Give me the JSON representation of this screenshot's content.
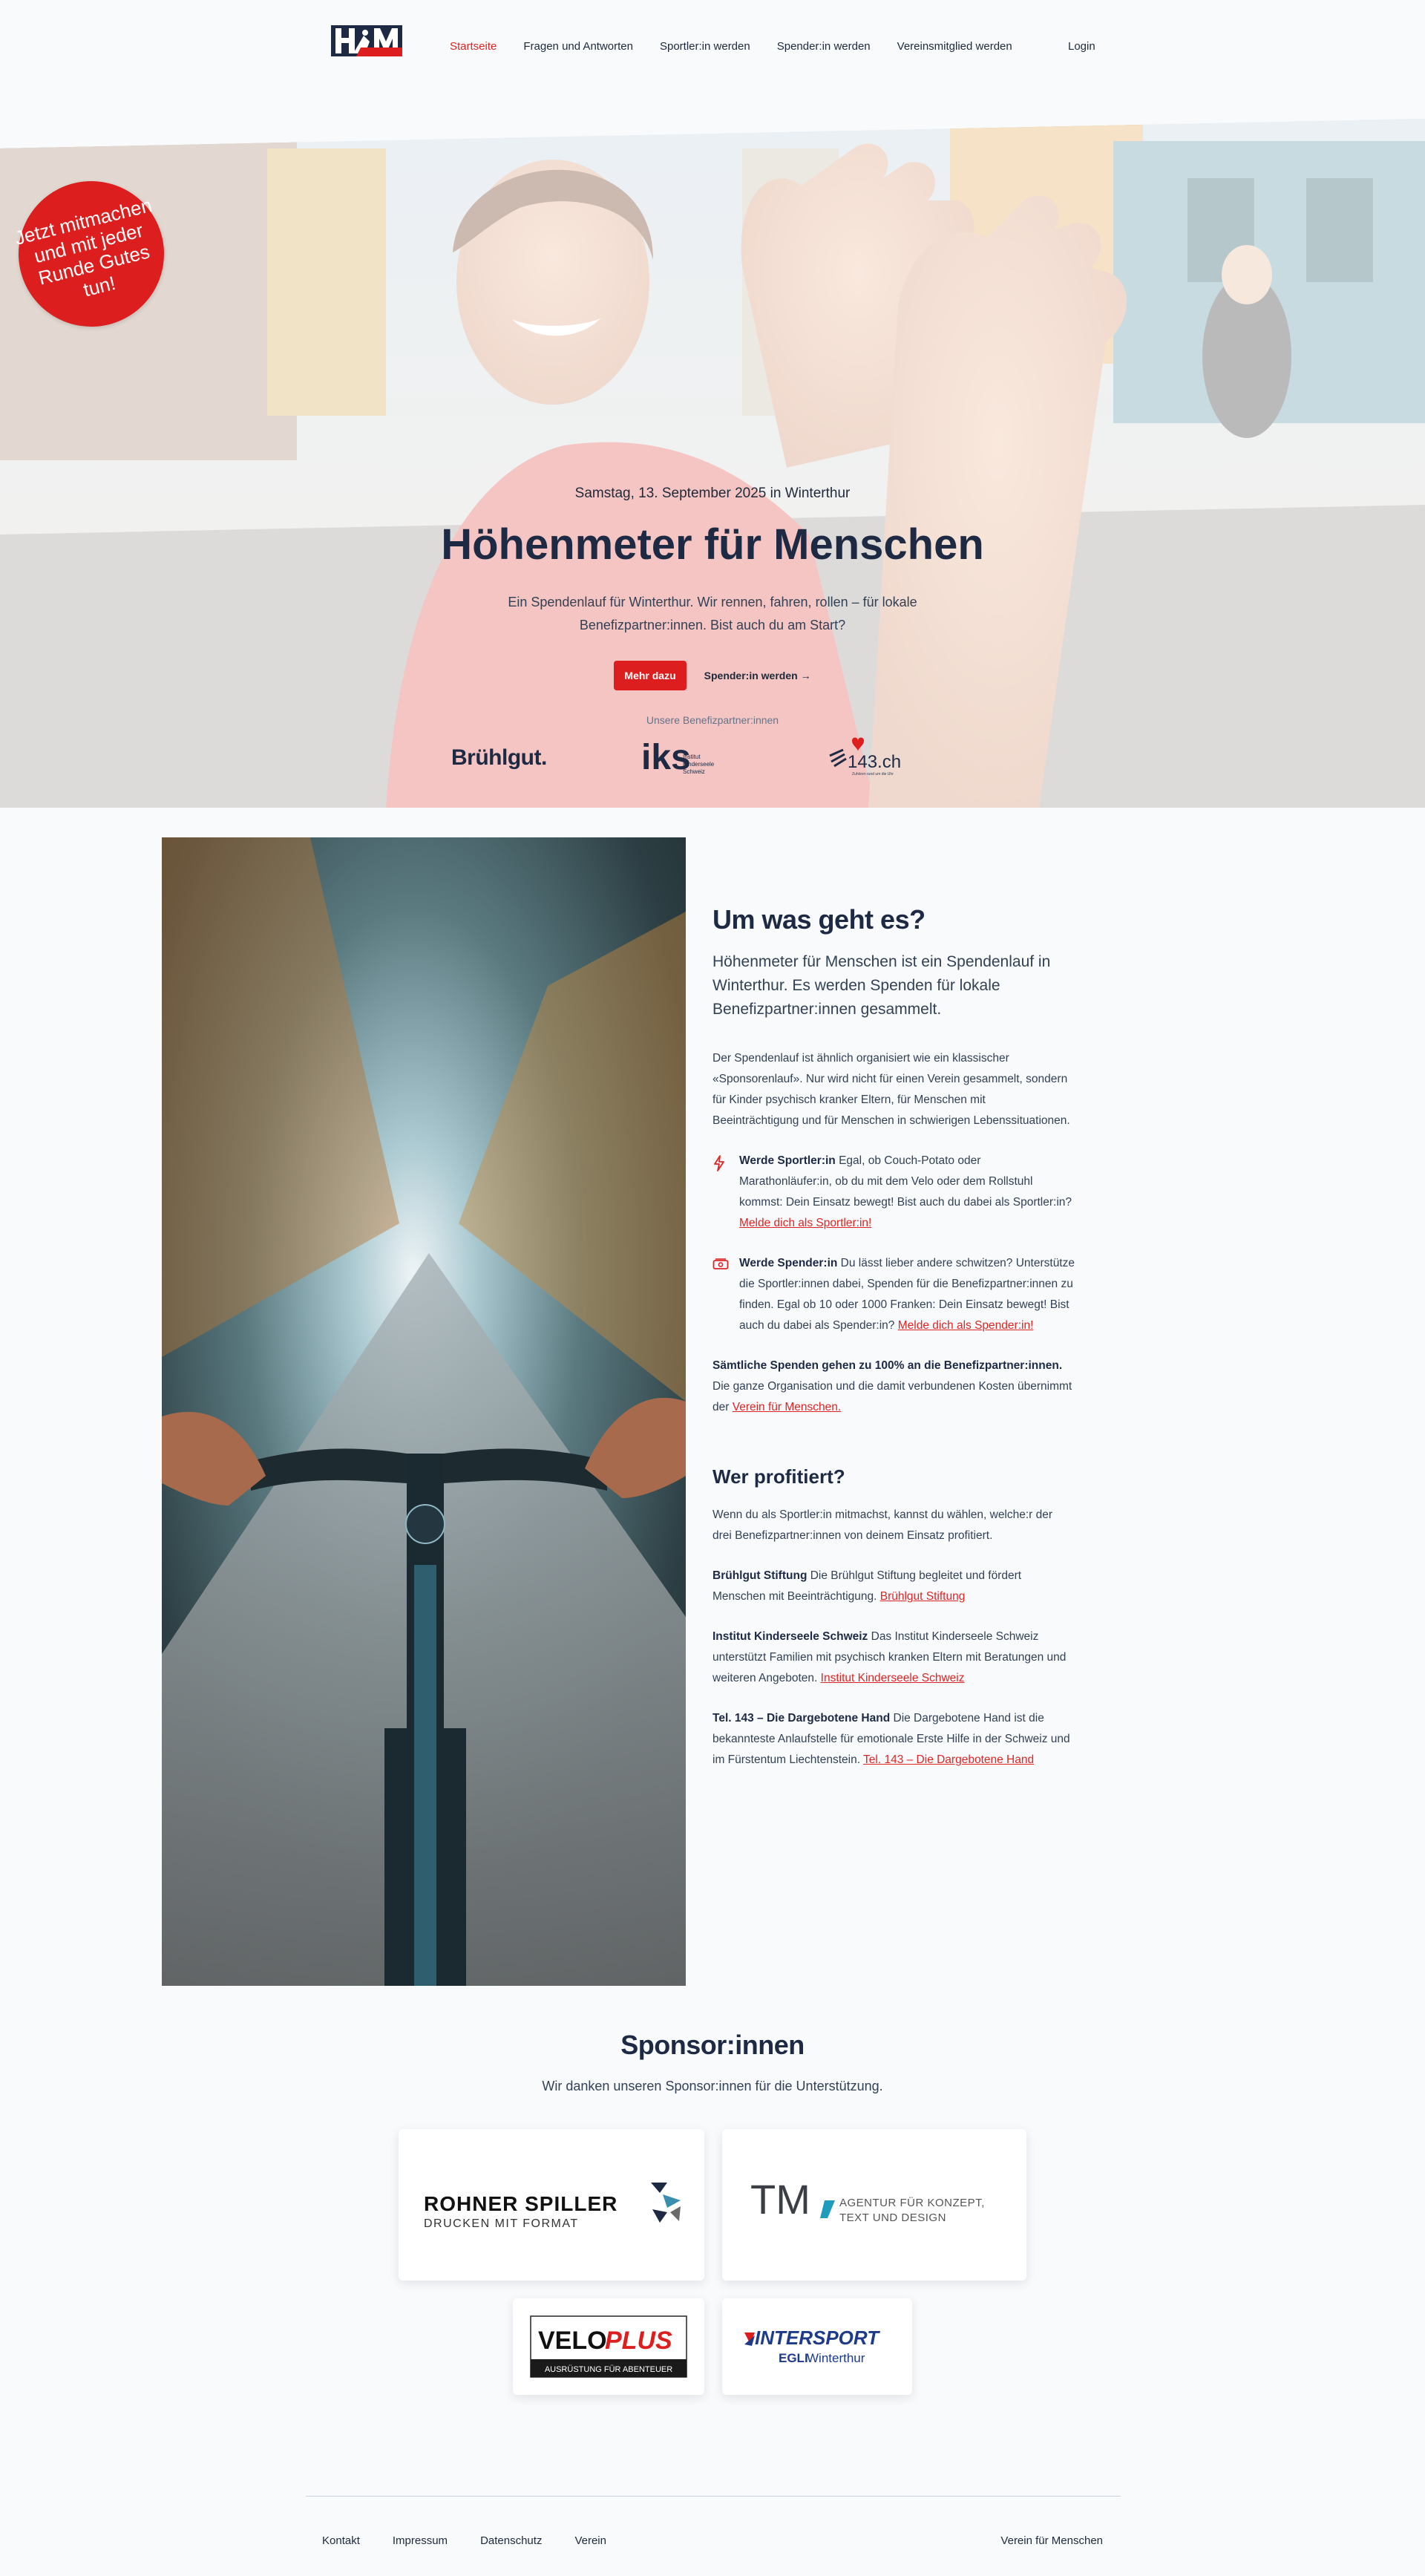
{
  "nav": {
    "items": [
      "Startseite",
      "Fragen und Antworten",
      "Sportler:in werden",
      "Spender:in werden",
      "Vereinsmitglied werden"
    ],
    "login": "Login"
  },
  "badge": "Jetzt mitmachen und mit jeder Runde Gutes tun!",
  "hero": {
    "date": "Samstag, 13. September 2025 in Winterthur",
    "title": "Höhenmeter für Menschen",
    "text": "Ein Spendenlauf für Winterthur. Wir rennen, fahren, rollen – für lokale Benefizpartner:innen. Bist auch du am Start?",
    "cta_primary": "Mehr dazu",
    "cta_secondary": "Spender:in werden →",
    "partners_label": "Unsere Benefizpartner:innen",
    "partner_bruehl": "Brühlgut.",
    "partner_iks": "iks",
    "partner_iks_lines": [
      "Institut",
      "Kinderseele",
      "Schweiz"
    ],
    "partner_143": "143.ch",
    "partner_143_sub": "Zuhören rund um die Uhr"
  },
  "about": {
    "title": "Um was geht es?",
    "lead": "Höhenmeter für Menschen ist ein Spendenlauf in Winterthur. Es werden Spenden für lokale Benefizpartner:innen gesammelt.",
    "para1": "Der Spendenlauf ist ähnlich organisiert wie ein klassischer «Sponsorenlauf». Nur wird nicht für einen Verein gesammelt, sondern für Kinder psychisch kranker Eltern, für Menschen mit Beeinträchtigung und für Menschen in schwierigen Lebenssituationen.",
    "sportler_bold": "Werde Sportler:in",
    "sportler_text": " Egal, ob Couch-Potato oder Marathonläufer:in, ob du mit dem Velo oder dem Rollstuhl kommst: Dein Einsatz bewegt! Bist auch du dabei als Sportler:in? ",
    "sportler_link": "Melde dich als Sportler:in!",
    "spender_bold": "Werde Spender:in",
    "spender_text": " Du lässt lieber andere schwitzen? Unterstütze die Sportler:innen dabei, Spenden für die Benefizpartner:innen zu finden. Egal ob 10 oder 1000 Franken: Dein Einsatz bewegt! Bist auch du dabei als Spender:in? ",
    "spender_link": "Melde dich als Spender:in!",
    "all_bold": "Sämtliche Spenden gehen zu 100% an die Benefizpartner:innen.",
    "all_text": " Die ganze Organisation und die damit verbundenen Kosten übernimmt der ",
    "all_link": "Verein für Menschen.",
    "profit_title": "Wer profitiert?",
    "profit_intro": "Wenn du als Sportler:in mitmachst, kannst du wählen, welche:r der drei Benefizpartner:innen von deinem Einsatz profitiert.",
    "p1_bold": "Brühlgut Stiftung",
    "p1_text": " Die Brühlgut Stiftung begleitet und fördert Menschen mit Beeinträchtigung. ",
    "p1_link": "Brühlgut Stiftung",
    "p2_bold": "Institut Kinderseele Schweiz",
    "p2_text": " Das Institut Kinderseele Schweiz unterstützt Familien mit psychisch kranken Eltern mit Beratungen und weiteren Angeboten. ",
    "p2_link": "Institut Kinderseele Schweiz",
    "p3_bold": "Tel. 143 – Die Dargebotene Hand",
    "p3_text": " Die Dargebotene Hand ist die bekannteste Anlaufstelle für emotionale Erste Hilfe in der Schweiz und im Fürstentum Liechtenstein. ",
    "p3_link": "Tel. 143 – Die Dargebotene Hand"
  },
  "sponsors": {
    "title": "Sponsor:innen",
    "subtitle": "Wir danken unseren Sponsor:innen für die Unterstützung.",
    "rohner_main": "ROHNER SPILLER",
    "rohner_sub": "DRUCKEN MIT FORMAT",
    "tm_main": "TM",
    "tm_sub1": "AGENTUR FÜR KONZEPT,",
    "tm_sub2": "TEXT UND DESIGN",
    "velo_a": "VELO",
    "velo_b": "PLUS",
    "velo_sub": "AUSRÜSTUNG FÜR ABENTEUER",
    "inter_main": "INTERSPORT",
    "inter_sub_a": "EGLI",
    "inter_sub_b": " Winterthur"
  },
  "footer": {
    "links": [
      "Kontakt",
      "Impressum",
      "Datenschutz",
      "Verein"
    ],
    "right": "Verein für Menschen"
  },
  "colors": {
    "accent": "#dc1e1e",
    "navy": "#1e2a44",
    "background": "#f8fafc"
  }
}
